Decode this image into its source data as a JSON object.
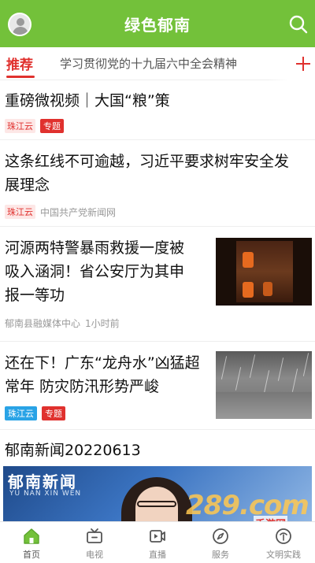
{
  "header": {
    "title": "绿色郁南",
    "avatar_icon": "user-avatar-icon",
    "search_icon": "search-icon",
    "bg_color": "#73c13a"
  },
  "tabs": {
    "active": "推荐",
    "items": [
      "学习贯彻党的十九届六中全会精神"
    ],
    "add_icon": "plus-icon",
    "accent_color": "#e0312e"
  },
  "news": [
    {
      "title_lines": [
        "重磅微视频｜大国“粮”策"
      ],
      "source": "珠江云",
      "tag": "专题"
    },
    {
      "title_lines": [
        "这条红线不可逾越，习近平要求树牢安全发",
        "展理念"
      ],
      "source": "珠江云",
      "source2": "中国共产党新闻网"
    },
    {
      "title_lines": [
        "河源两特警暴雨救援一度被",
        "吸入涵洞！省公安厅为其申",
        "报一等功"
      ],
      "source": "郁南县融媒体中心",
      "time": "1小时前"
    },
    {
      "title_lines": [
        "还在下！广东“龙舟水”凶猛超",
        "常年 防灾防汛形势严峻"
      ],
      "source": "珠江云",
      "tag": "专题"
    }
  ],
  "video": {
    "title": "郁南新闻20220613",
    "logo_main": "郁南新闻",
    "logo_sub": "YU NAN XIN WEN"
  },
  "watermark": {
    "main": "289.com",
    "sub": "手游网"
  },
  "bottom_nav": [
    {
      "label": "首页",
      "icon": "home-icon",
      "active": true
    },
    {
      "label": "电视",
      "icon": "tv-icon",
      "active": false
    },
    {
      "label": "直播",
      "icon": "live-video-icon",
      "active": false
    },
    {
      "label": "服务",
      "icon": "compass-icon",
      "active": false
    },
    {
      "label": "文明实践",
      "icon": "civilization-practice-icon",
      "active": false
    }
  ]
}
